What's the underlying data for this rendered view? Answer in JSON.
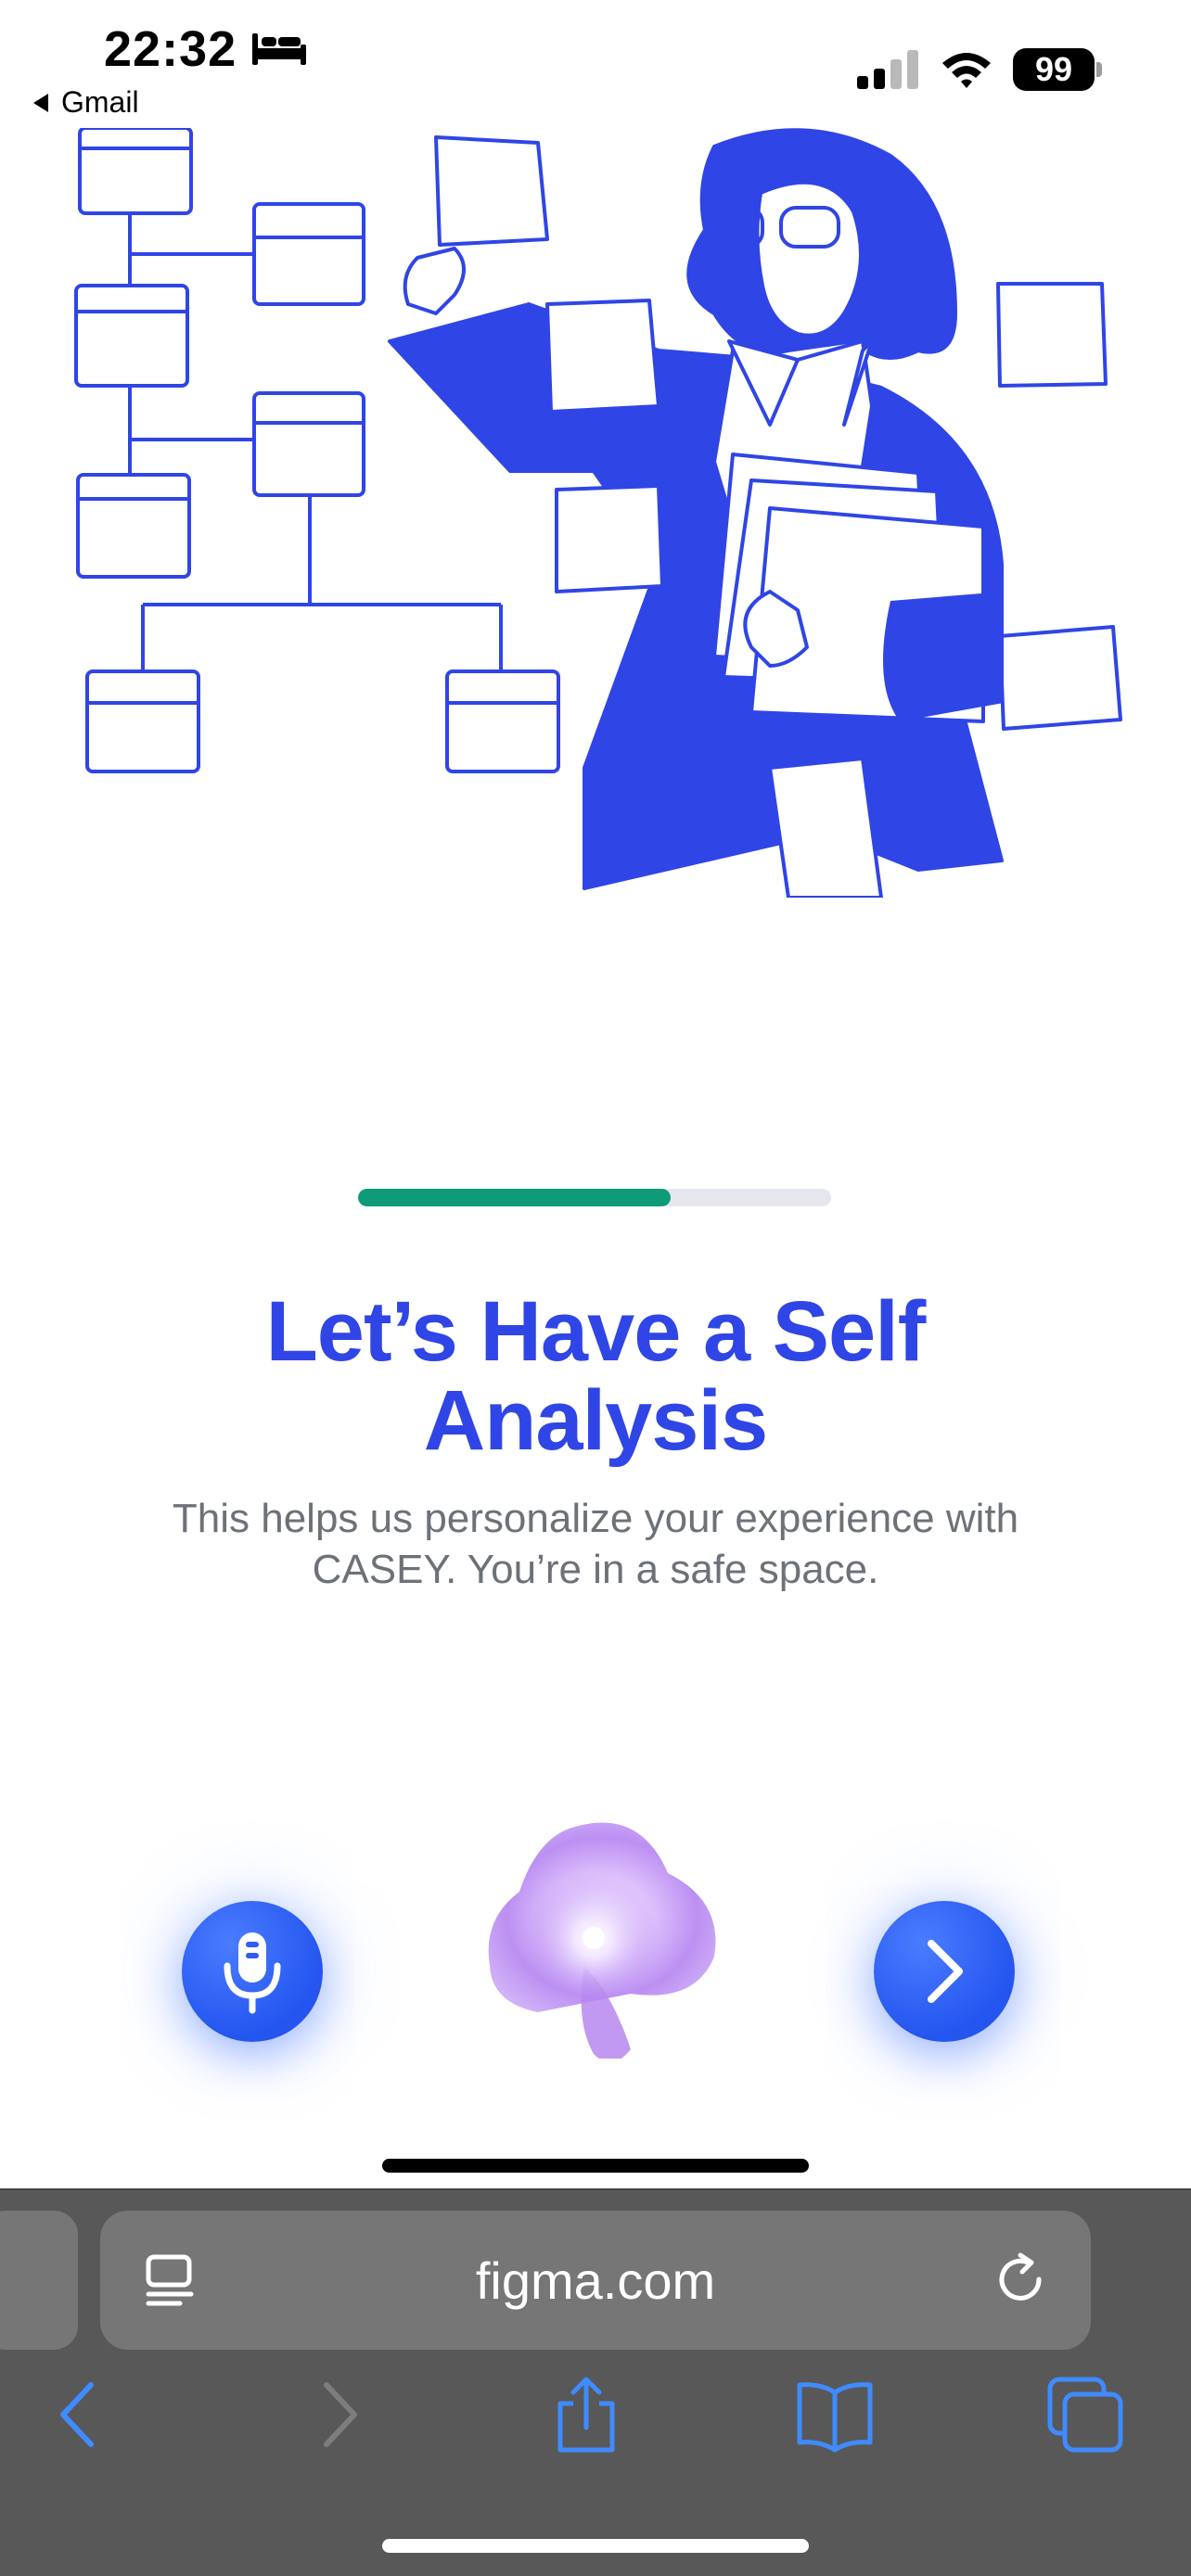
{
  "status_bar": {
    "time": "22:32",
    "back_app_label": "Gmail",
    "battery_level": "99",
    "icons": [
      "bed-icon",
      "signal-icon",
      "wifi-icon",
      "battery-icon"
    ]
  },
  "illustration": {
    "icon": "woman-organizing-cards-illustration",
    "accent_color": "#2f45e6"
  },
  "progress": {
    "fraction": 0.66,
    "fill_color": "#0f9a78",
    "track_color": "#e6e7ee"
  },
  "heading": {
    "title": "Let’s Have a Self Analysis",
    "subtitle": "This helps us personalize your experience with CASEY. You’re in a safe space."
  },
  "actions": {
    "mic_icon": "microphone-icon",
    "next_icon": "chevron-right-icon",
    "orb_icon": "casey-orb-icon",
    "button_color": "#2f5bf2"
  },
  "browser": {
    "url": "figma.com",
    "icons": [
      "reader-icon",
      "reload-icon",
      "back-icon",
      "forward-icon",
      "share-icon",
      "bookmarks-icon",
      "tabs-icon"
    ]
  }
}
